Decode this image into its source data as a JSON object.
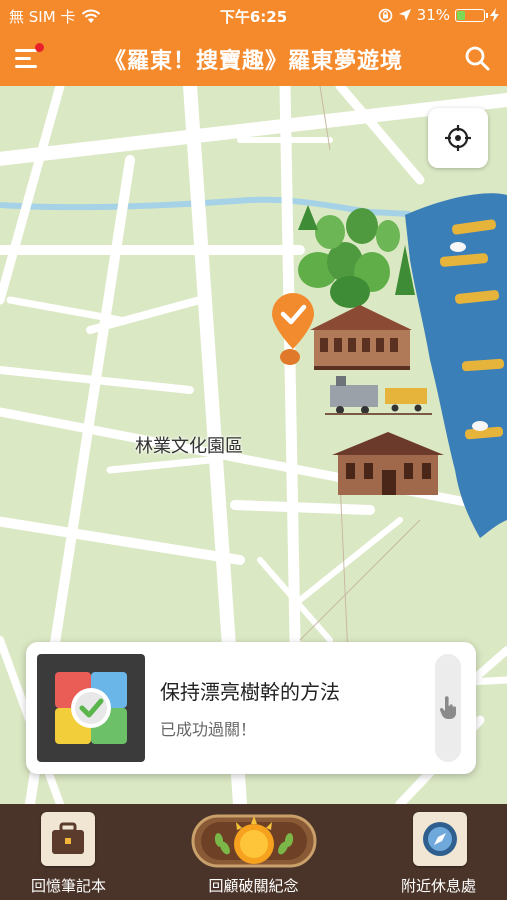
{
  "status_bar": {
    "carrier": "無 SIM 卡",
    "time": "下午6:25",
    "battery_percent": "31%",
    "battery_level": 0.31,
    "wifi_icon": "wifi-icon",
    "location_icon": "location-arrow-icon"
  },
  "nav": {
    "title": "《羅東！搜寶趣》羅東夢遊境",
    "menu_icon": "menu-icon",
    "search_icon": "search-icon",
    "accent_color": "#f58a2d"
  },
  "map": {
    "place_label": "林業文化園區",
    "locate_icon": "crosshair-icon",
    "marker_icon": "check-marker-icon"
  },
  "card": {
    "title": "保持漂亮樹幹的方法",
    "status": "已成功過關！",
    "thumb_icon": "puzzle-check-icon",
    "handle_icon": "hand-pointer-icon"
  },
  "tabs": [
    {
      "label": "回憶筆記本",
      "icon": "briefcase-icon"
    },
    {
      "label": "回顧破關紀念",
      "icon": "sun-laurel-badge-icon"
    },
    {
      "label": "附近休息處",
      "icon": "compass-icon"
    }
  ]
}
